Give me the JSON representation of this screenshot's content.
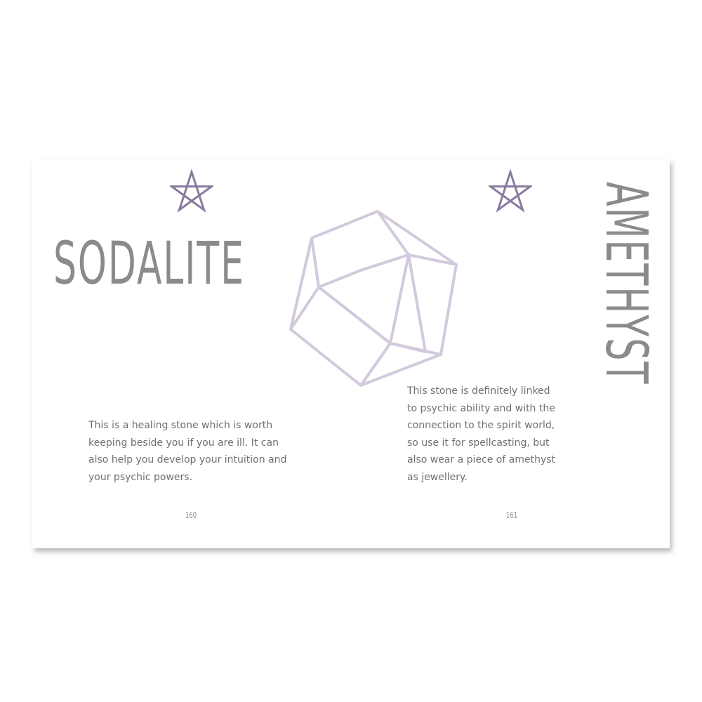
{
  "left_page": {
    "title": "SODALITE",
    "body_lines": [
      "This is a healing stone which is worth",
      "keeping beside you if you are ill. It can",
      "also help you develop your intuition and",
      "your psychic powers."
    ],
    "page_number": "160"
  },
  "right_page": {
    "title": "AMETHYST",
    "body_lines": [
      "This stone is definitely linked",
      "to psychic ability and with the",
      "connection to the spirit world,",
      "so use it for spellcasting, but",
      "also wear a piece of amethyst",
      "as jewellery."
    ],
    "page_number": "161"
  },
  "colors": {
    "title_gray": "#8b8b8e",
    "body_gray": "#6f6f72",
    "star_purple": "#8a7a9e",
    "crystal_lavender": "#d2cadc"
  },
  "icons": {
    "star": "pentagram-icon",
    "crystal": "crystal-icon"
  }
}
